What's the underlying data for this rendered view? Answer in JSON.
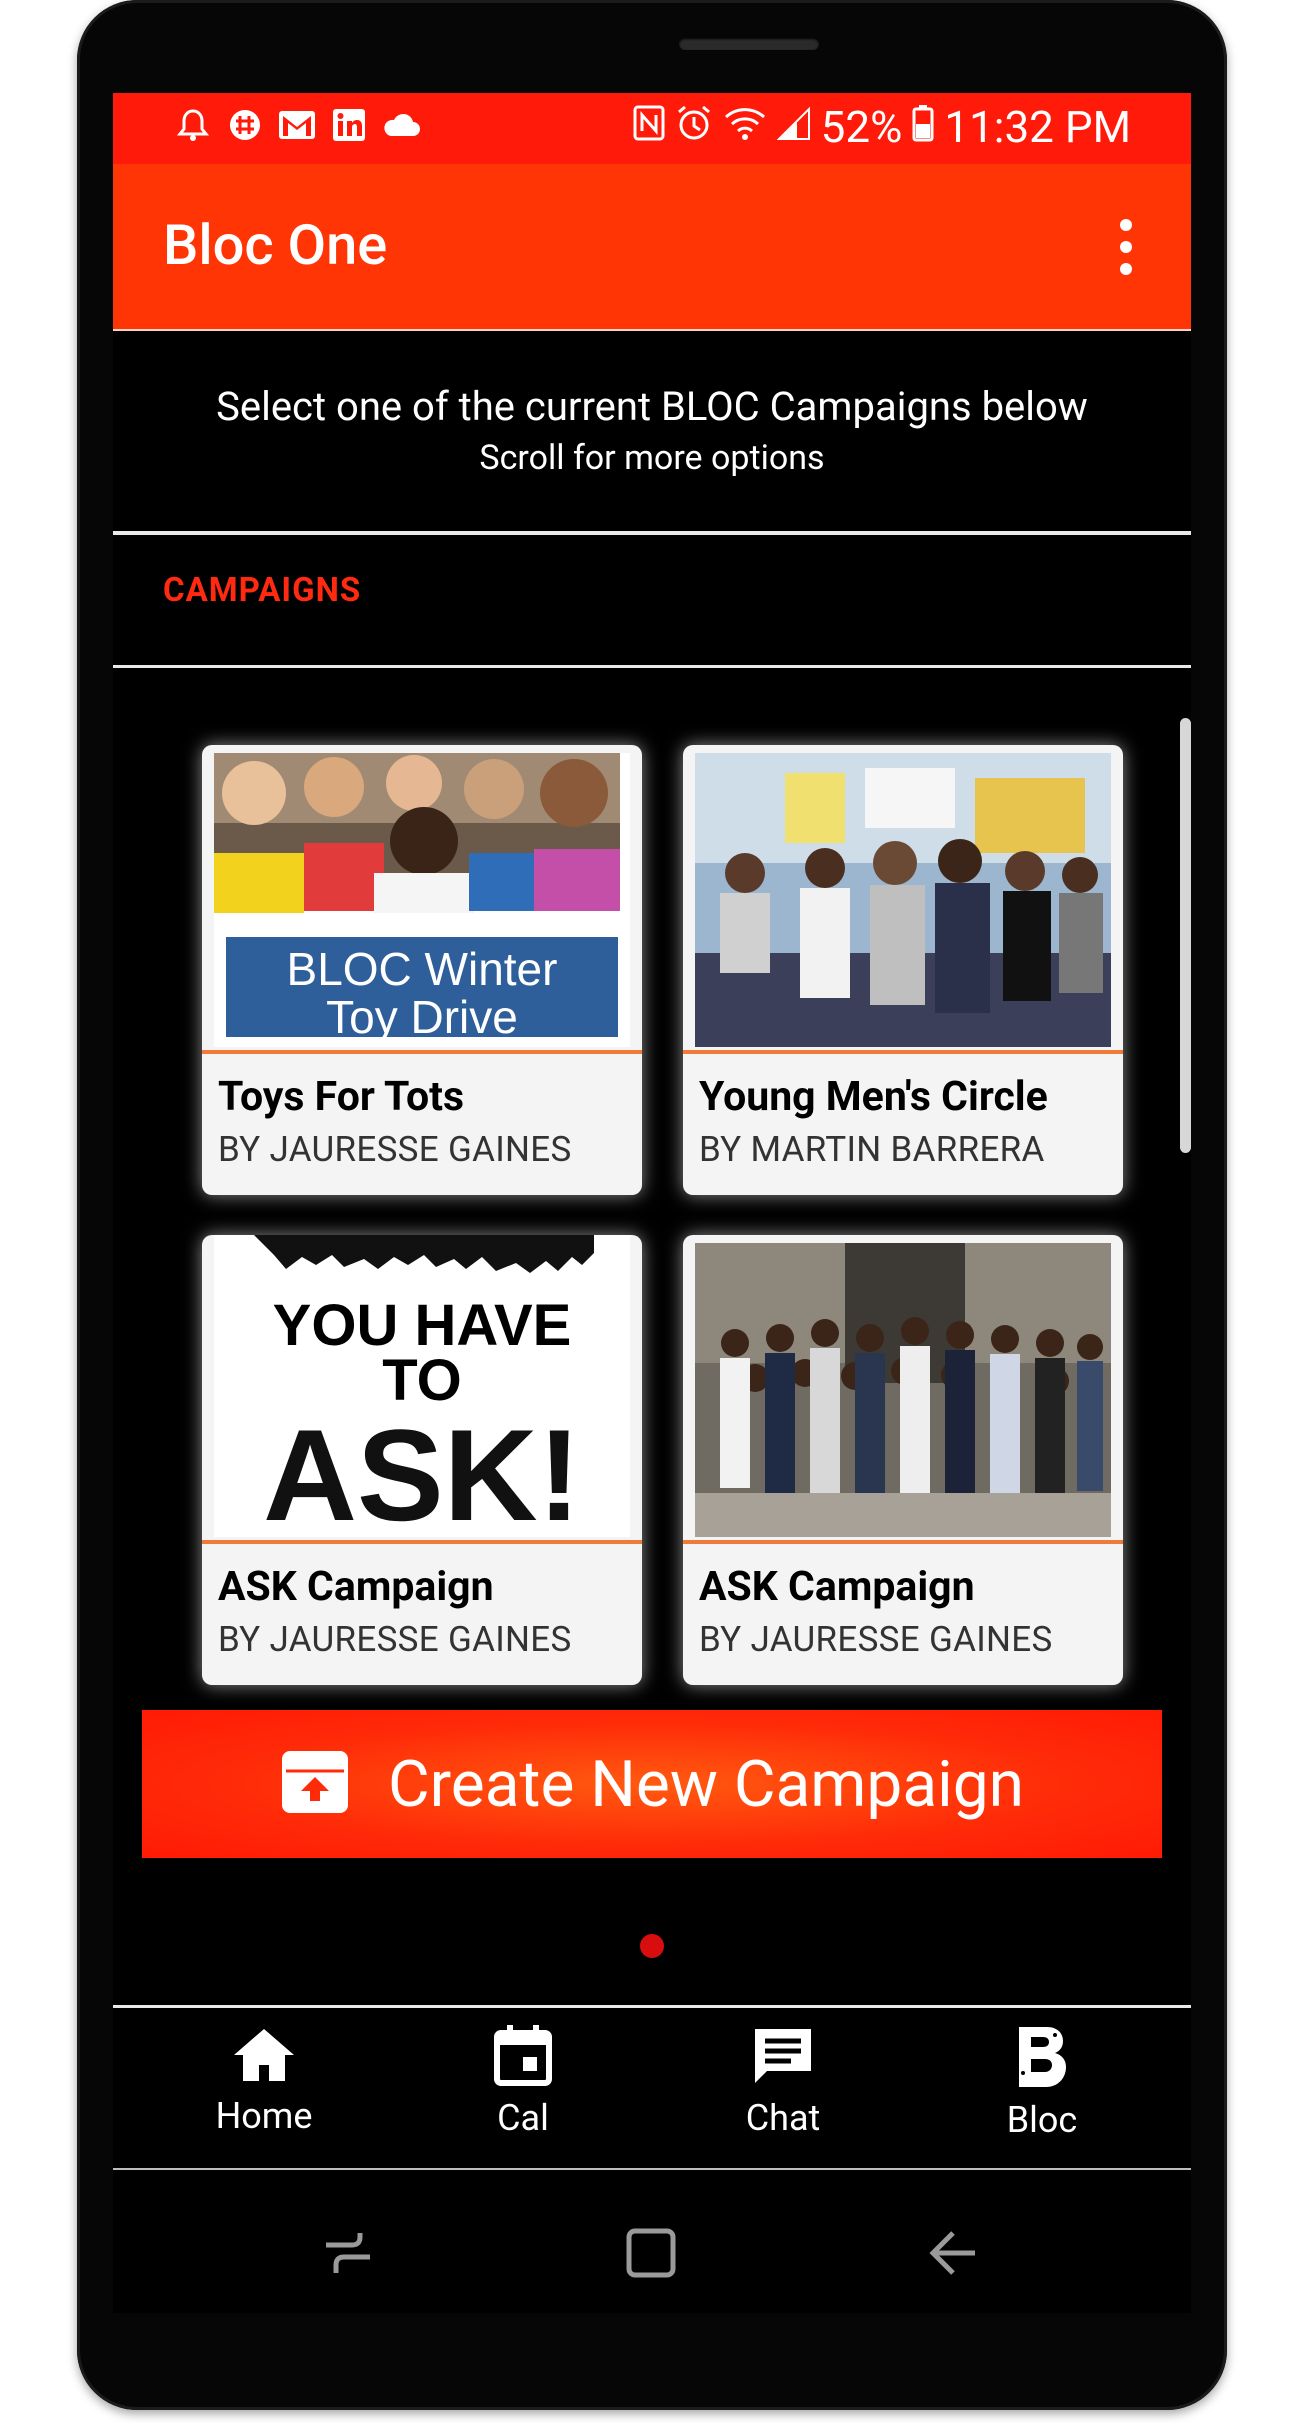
{
  "status_bar": {
    "battery": "52%",
    "time": "11:32 PM"
  },
  "app_bar": {
    "title": "Bloc One"
  },
  "intro": {
    "line1": "Select one of the current BLOC Campaigns below",
    "line2": "Scroll for more options"
  },
  "section_label": "CAMPAIGNS",
  "campaigns": [
    {
      "title": "Toys For Tots",
      "author": "BY JAURESSE GAINES",
      "image_text": "BLOC Winter Toy Drive"
    },
    {
      "title": "Young Men's Circle",
      "author": "BY MARTIN BARRERA"
    },
    {
      "title": "ASK Campaign",
      "author": "BY JAURESSE GAINES",
      "image_text": "YOU HAVE TO ASK!"
    },
    {
      "title": "ASK Campaign",
      "author": "BY JAURESSE GAINES"
    }
  ],
  "create_button": {
    "label": "Create New Campaign"
  },
  "bottom_nav": [
    {
      "label": "Home"
    },
    {
      "label": "Cal"
    },
    {
      "label": "Chat"
    },
    {
      "label": "Bloc"
    }
  ],
  "colors": {
    "status_bar": "#ff1a0a",
    "app_bar": "#ff3506",
    "accent": "#ff2a10",
    "background": "#000000"
  }
}
